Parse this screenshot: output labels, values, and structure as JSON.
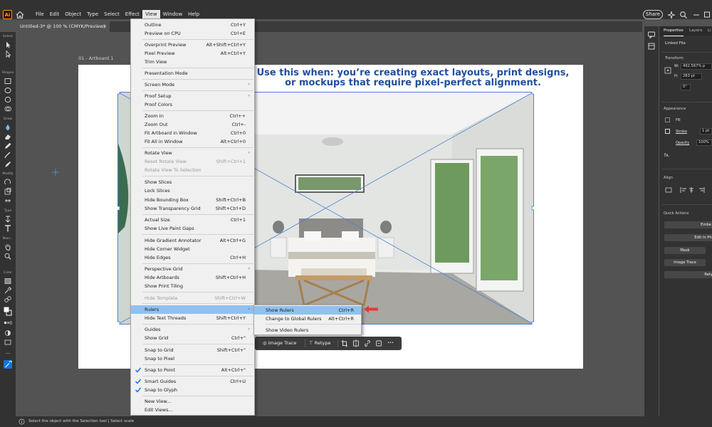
{
  "app": {
    "logo_text": "Ai"
  },
  "menubar": {
    "items": [
      "File",
      "Edit",
      "Object",
      "Type",
      "Select",
      "Effect",
      "View",
      "Window",
      "Help"
    ],
    "active_item": "View",
    "share_label": "Share"
  },
  "document": {
    "tab_title": "Untitled-3* @ 100 % (CMYK/Preview)",
    "tab_close": "×",
    "artboard_label": "01 - Artboard 1"
  },
  "toolbar": {
    "section_labels": [
      "Select",
      "Shapes",
      "Draw",
      "Modify",
      "Type",
      "Navi...",
      "Color"
    ],
    "more": "..."
  },
  "headline": {
    "line1": "Use this when: you’re creating exact layouts, print designs,",
    "line2": "or mockups that require pixel-perfect alignment."
  },
  "view_menu": {
    "items": [
      {
        "label": "Outline",
        "shortcut": "Ctrl+Y"
      },
      {
        "label": "Preview on CPU",
        "shortcut": "Ctrl+E"
      },
      {
        "label": "Overprint Preview",
        "shortcut": "Alt+Shift+Ctrl+Y"
      },
      {
        "label": "Pixel Preview",
        "shortcut": "Alt+Ctrl+Y"
      },
      {
        "label": "Trim View",
        "shortcut": ""
      },
      {
        "label": "Presentation Mode",
        "shortcut": ""
      },
      {
        "label": "Screen Mode",
        "shortcut": "",
        "submenu": true
      },
      {
        "label": "Proof Setup",
        "shortcut": "",
        "submenu": true
      },
      {
        "label": "Proof Colors",
        "shortcut": ""
      },
      {
        "label": "Zoom In",
        "shortcut": "Ctrl++"
      },
      {
        "label": "Zoom Out",
        "shortcut": "Ctrl+-"
      },
      {
        "label": "Fit Artboard in Window",
        "shortcut": "Ctrl+0"
      },
      {
        "label": "Fit All in Window",
        "shortcut": "Alt+Ctrl+0"
      },
      {
        "label": "Rotate View",
        "shortcut": "",
        "submenu": true
      },
      {
        "label": "Reset Rotate View",
        "shortcut": "Shift+Ctrl+1",
        "disabled": true
      },
      {
        "label": "Rotate View To Selection",
        "shortcut": "",
        "disabled": true
      },
      {
        "label": "Show Slices",
        "shortcut": ""
      },
      {
        "label": "Lock Slices",
        "shortcut": ""
      },
      {
        "label": "Hide Bounding Box",
        "shortcut": "Shift+Ctrl+B"
      },
      {
        "label": "Show Transparency Grid",
        "shortcut": "Shift+Ctrl+D"
      },
      {
        "label": "Actual Size",
        "shortcut": "Ctrl+1"
      },
      {
        "label": "Show Live Paint Gaps",
        "shortcut": ""
      },
      {
        "label": "Hide Gradient Annotator",
        "shortcut": "Alt+Ctrl+G"
      },
      {
        "label": "Hide Corner Widget",
        "shortcut": ""
      },
      {
        "label": "Hide Edges",
        "shortcut": "Ctrl+H"
      },
      {
        "label": "Perspective Grid",
        "shortcut": "",
        "submenu": true
      },
      {
        "label": "Hide Artboards",
        "shortcut": "Shift+Ctrl+H"
      },
      {
        "label": "Show Print Tiling",
        "shortcut": ""
      },
      {
        "label": "Hide Template",
        "shortcut": "Shift+Ctrl+W",
        "disabled": true
      },
      {
        "label": "Rulers",
        "shortcut": "",
        "submenu": true,
        "highlighted": true
      },
      {
        "label": "Hide Text Threads",
        "shortcut": "Shift+Ctrl+Y"
      },
      {
        "label": "Guides",
        "shortcut": "",
        "submenu": true
      },
      {
        "label": "Show Grid",
        "shortcut": "Ctrl+\""
      },
      {
        "label": "Snap to Grid",
        "shortcut": "Shift+Ctrl+\""
      },
      {
        "label": "Snap to Pixel",
        "shortcut": ""
      },
      {
        "label": "Snap to Point",
        "shortcut": "Alt+Ctrl+\"",
        "checked": true
      },
      {
        "label": "Smart Guides",
        "shortcut": "Ctrl+U",
        "checked": true
      },
      {
        "label": "Snap to Glyph",
        "shortcut": "",
        "checked": true
      },
      {
        "label": "New View...",
        "shortcut": ""
      },
      {
        "label": "Edit Views...",
        "shortcut": ""
      }
    ]
  },
  "rulers_submenu": {
    "items": [
      {
        "label": "Show Rulers",
        "shortcut": "Ctrl+R",
        "highlighted": true
      },
      {
        "label": "Change to Global Rulers",
        "shortcut": "Alt+Ctrl+R"
      },
      {
        "label": "Show Video Rulers",
        "shortcut": ""
      }
    ]
  },
  "taskbar": {
    "image_trace": "Image Trace",
    "retype": "Retype",
    "more": "•••"
  },
  "right_panel": {
    "tabs": [
      "Properties",
      "Layers",
      "Li"
    ],
    "linked_file": "Linked File",
    "transform_heading": "Transform",
    "width": "492.567% p",
    "height": "283 pt",
    "rotation": "0°",
    "appearance_heading": "Appearance",
    "fill_label": "Fill",
    "stroke_label": "Stroke",
    "stroke_value": "1 pt",
    "opacity_label": "Opacity",
    "opacity_value": "100%",
    "fx_label": "fx.",
    "align_heading": "Align",
    "quick_actions_heading": "Quick Actions",
    "buttons": [
      "Embe",
      "Edit In Pho",
      "Mask",
      "Image Trace",
      "Rety"
    ]
  },
  "status": {
    "text": "Select the object with the Selection tool  |  Select scale"
  },
  "colors": {
    "accent": "#1473e6",
    "menu_highlight": "#91c1f0",
    "headline": "#1f4fa0",
    "arrow": "#e53935"
  }
}
